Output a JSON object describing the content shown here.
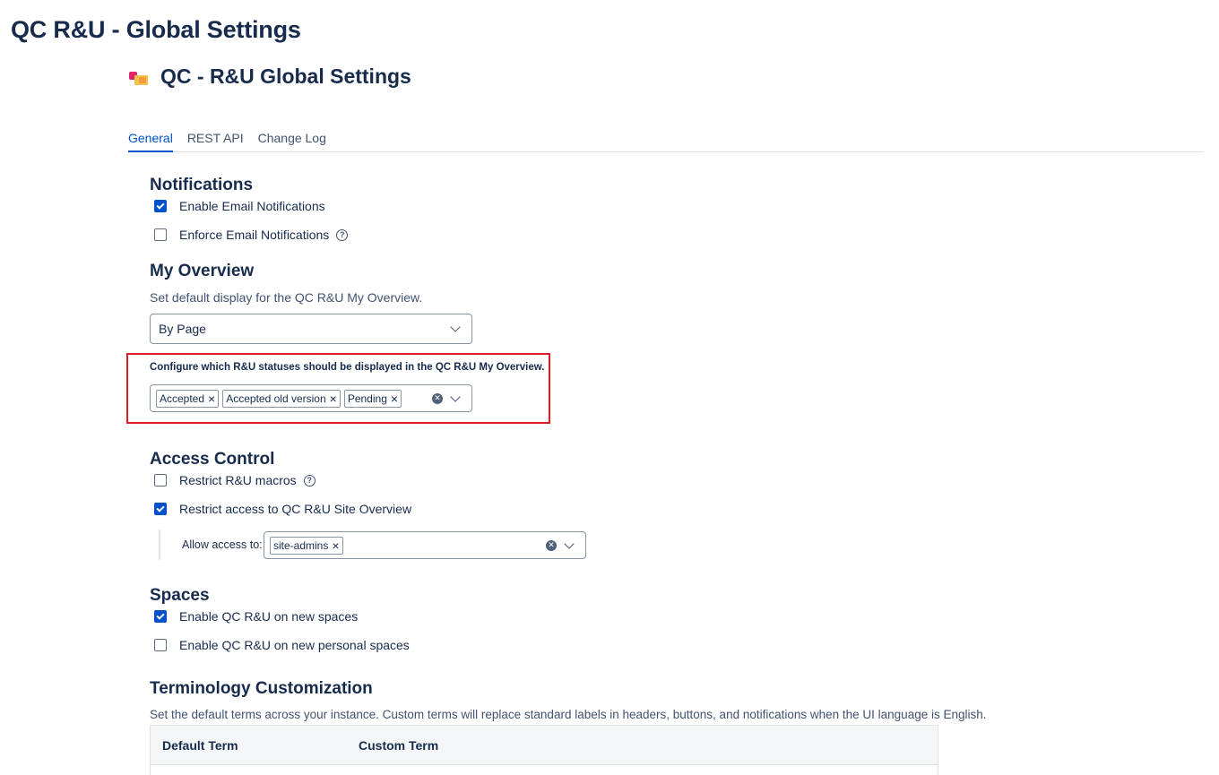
{
  "page": {
    "title": "QC R&U - Global Settings"
  },
  "app": {
    "title": "QC - R&U Global Settings",
    "logo_icon": "qc-ru-app-logo-icon"
  },
  "tabs": [
    {
      "label": "General",
      "active": true
    },
    {
      "label": "REST API",
      "active": false
    },
    {
      "label": "Change Log",
      "active": false
    }
  ],
  "notifications": {
    "title": "Notifications",
    "enable_email": {
      "label": "Enable Email Notifications",
      "checked": true
    },
    "enforce_email": {
      "label": "Enforce Email Notifications",
      "checked": false,
      "help_icon": "?"
    }
  },
  "my_overview": {
    "title": "My Overview",
    "description": "Set default display for the QC R&U My Overview.",
    "display_select": {
      "value": "By Page"
    },
    "statuses_label": "Configure which R&U statuses should be displayed in the QC R&U My Overview.",
    "statuses": [
      "Accepted",
      "Accepted old version",
      "Pending"
    ]
  },
  "access_control": {
    "title": "Access Control",
    "restrict_macros": {
      "label": "Restrict R&U macros",
      "checked": false,
      "help_icon": "?"
    },
    "restrict_site_overview": {
      "label": "Restrict access to QC R&U Site Overview",
      "checked": true
    },
    "allow_access_label": "Allow access to:",
    "allow_access_groups": [
      "site-admins"
    ]
  },
  "spaces": {
    "title": "Spaces",
    "enable_new_spaces": {
      "label": "Enable QC R&U on new spaces",
      "checked": true
    },
    "enable_personal_spaces": {
      "label": "Enable QC R&U on new personal spaces",
      "checked": false
    }
  },
  "terminology": {
    "title": "Terminology Customization",
    "description": "Set the default terms across your instance. Custom terms will replace standard labels in headers, buttons, and notifications when the UI language is English.",
    "columns": [
      "Default Term",
      "Custom Term"
    ]
  },
  "colors": {
    "accent": "#0052cc",
    "highlight_border": "#e01b24",
    "text": "#172b4d"
  }
}
